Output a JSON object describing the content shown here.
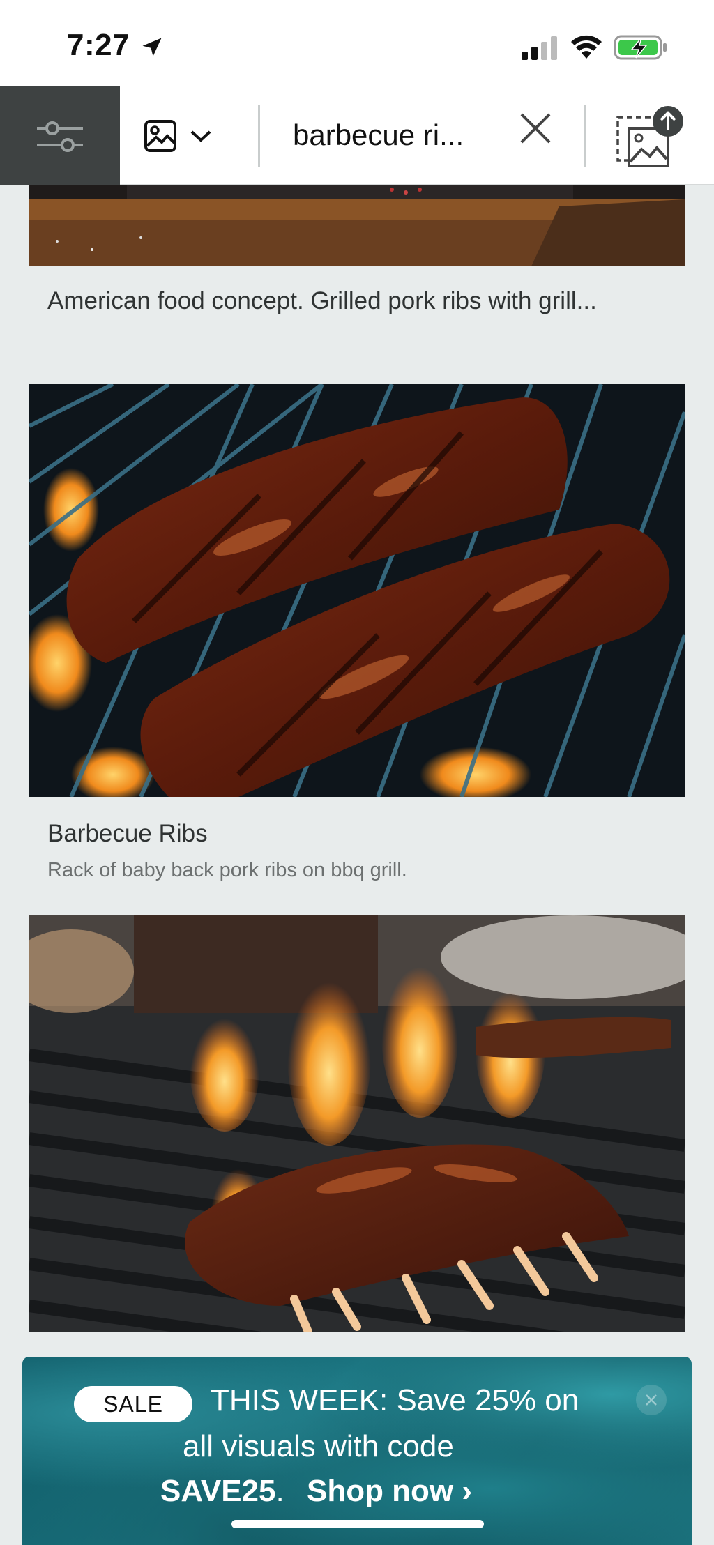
{
  "status_bar": {
    "time": "7:27"
  },
  "toolbar": {
    "filter_icon": "sliders-icon",
    "media_type_icon": "image-icon",
    "search_value": "barbecue ri...",
    "clear_icon": "close-icon",
    "reverse_image_icon": "image-upload-icon"
  },
  "results": [
    {
      "title": "American food concept. Grilled pork ribs with grill...",
      "description": ""
    },
    {
      "title": "Barbecue Ribs",
      "description": "Rack of baby back pork ribs on bbq grill."
    }
  ],
  "promo": {
    "badge": "SALE",
    "line1": "THIS WEEK: Save 25% on",
    "line2": "all visuals with code",
    "code": "SAVE25",
    "code_suffix": ".",
    "link": "Shop now ›"
  },
  "colors": {
    "toolbar_dark": "#3e4242",
    "page_bg": "#e8ecec",
    "promo_teal": "#1b7480"
  }
}
